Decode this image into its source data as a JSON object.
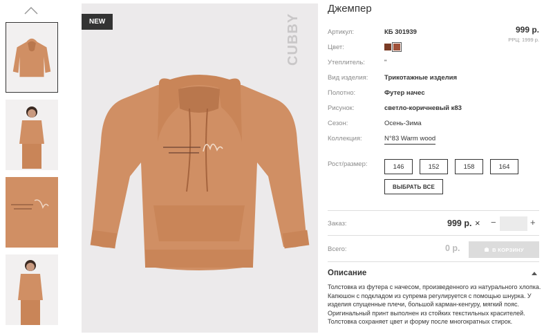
{
  "product": {
    "title": "Джемпер",
    "badge": "NEW",
    "brand": "CUBBY"
  },
  "price": {
    "main": "999 р.",
    "rrc": "РРЦ: 1999 р."
  },
  "props": [
    {
      "label": "Артикул:",
      "value": "КБ 301939",
      "bold": true
    },
    {
      "label": "Цвет:",
      "value": "",
      "type": "swatches"
    },
    {
      "label": "Утеплитель:",
      "value": "\"",
      "bold": false
    },
    {
      "label": "Вид изделия:",
      "value": "Трикотажные изделия",
      "bold": true
    },
    {
      "label": "Полотно:",
      "value": "Футер начес",
      "bold": true
    },
    {
      "label": "Рисунок:",
      "value": "светло-коричневый к83",
      "bold": true
    },
    {
      "label": "Сезон:",
      "value": "Осень-Зима",
      "bold": false
    },
    {
      "label": "Коллекция:",
      "value": "N°83 Warm wood",
      "bold": false,
      "type": "link"
    }
  ],
  "colors": [
    {
      "name": "brown",
      "hex": "#7a3b25"
    },
    {
      "name": "light-brown",
      "hex": "#a0523a",
      "selected": true
    }
  ],
  "sizes": {
    "label": "Рост/размер:",
    "options": [
      "146",
      "152",
      "158",
      "164"
    ],
    "select_all": "ВЫБРАТЬ ВСЕ"
  },
  "order": {
    "label": "Заказ:",
    "price": "999 р.",
    "remove": "×",
    "minus": "−",
    "plus": "+",
    "qty": ""
  },
  "total": {
    "label": "Всего:",
    "value": "0 р.",
    "cart_button": "В КОРЗИНУ"
  },
  "description": {
    "title": "Описание",
    "text": "Толстовка из футера с начесом, произведенного из натурального хлопка. Капюшон с подкладом из супрема регулируется с помощью шнурка. У изделия спущенные плечи, большой карман-кенгуру, мягкий пояс. Оригинальный принт выполнен из стойких текстильных красителей. Толстовка сохраняет цвет и форму после многократных стирок."
  },
  "accent_colors": {
    "garment": "#d08f64",
    "garment_shadow": "#b9774d",
    "badge_bg": "#333333",
    "image_bg": "#eceaeb"
  }
}
